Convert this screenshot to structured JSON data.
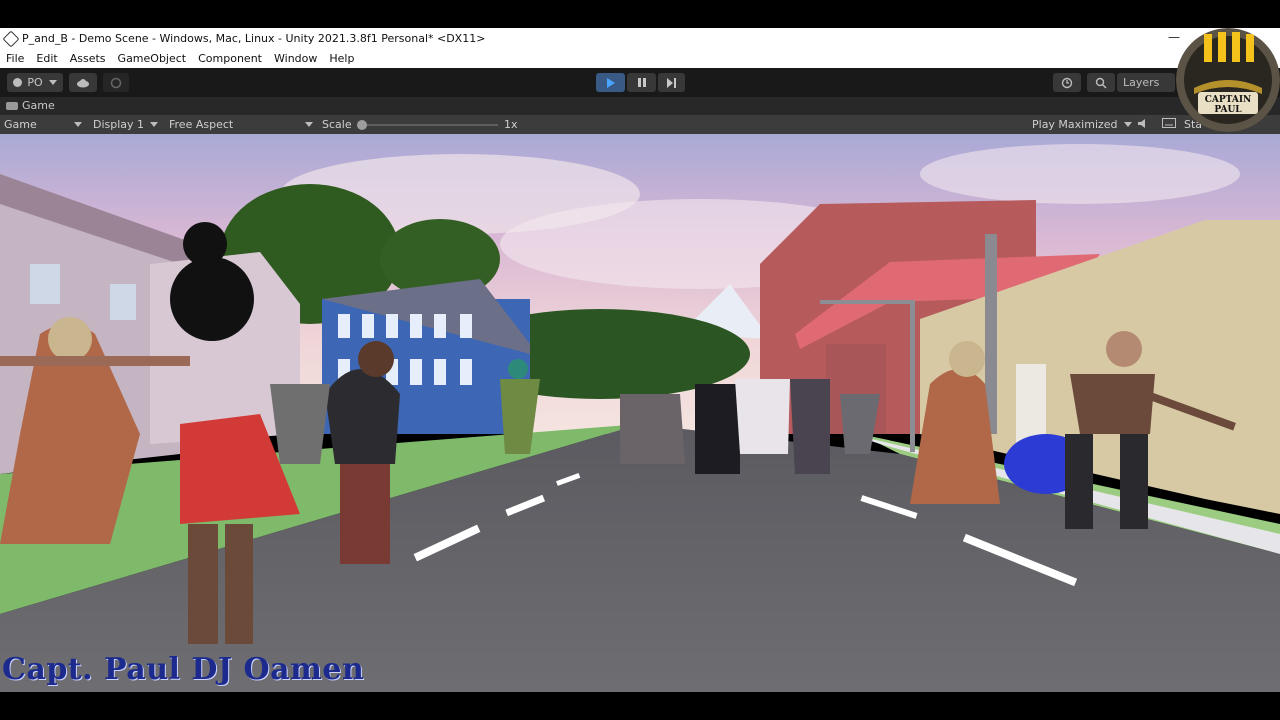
{
  "window": {
    "title": "P_and_B - Demo Scene - Windows, Mac, Linux - Unity 2021.3.8f1 Personal* <DX11>",
    "minimize_glyph": "—"
  },
  "menu": [
    "File",
    "Edit",
    "Assets",
    "GameObject",
    "Component",
    "Window",
    "Help"
  ],
  "toolbar": {
    "account_label": "PO",
    "layers_label": "Layers",
    "play_state": "playing"
  },
  "game_tab": {
    "label": "Game"
  },
  "game_bar": {
    "view_mode": "Game",
    "display": "Display 1",
    "aspect": "Free Aspect",
    "scale_label": "Scale",
    "scale_value": "1x",
    "play_mode": "Play Maximized",
    "stats_label": "Sta"
  },
  "logo_badge": {
    "text": "CAPTAIN PAUL"
  },
  "watermark": {
    "text": "Capt. Paul DJ Oamen"
  },
  "colors": {
    "editor_dark": "#191919",
    "play_accent": "#4aa3ff",
    "watermark": "#1b2a8c",
    "building_blue": "#3d67b4"
  }
}
